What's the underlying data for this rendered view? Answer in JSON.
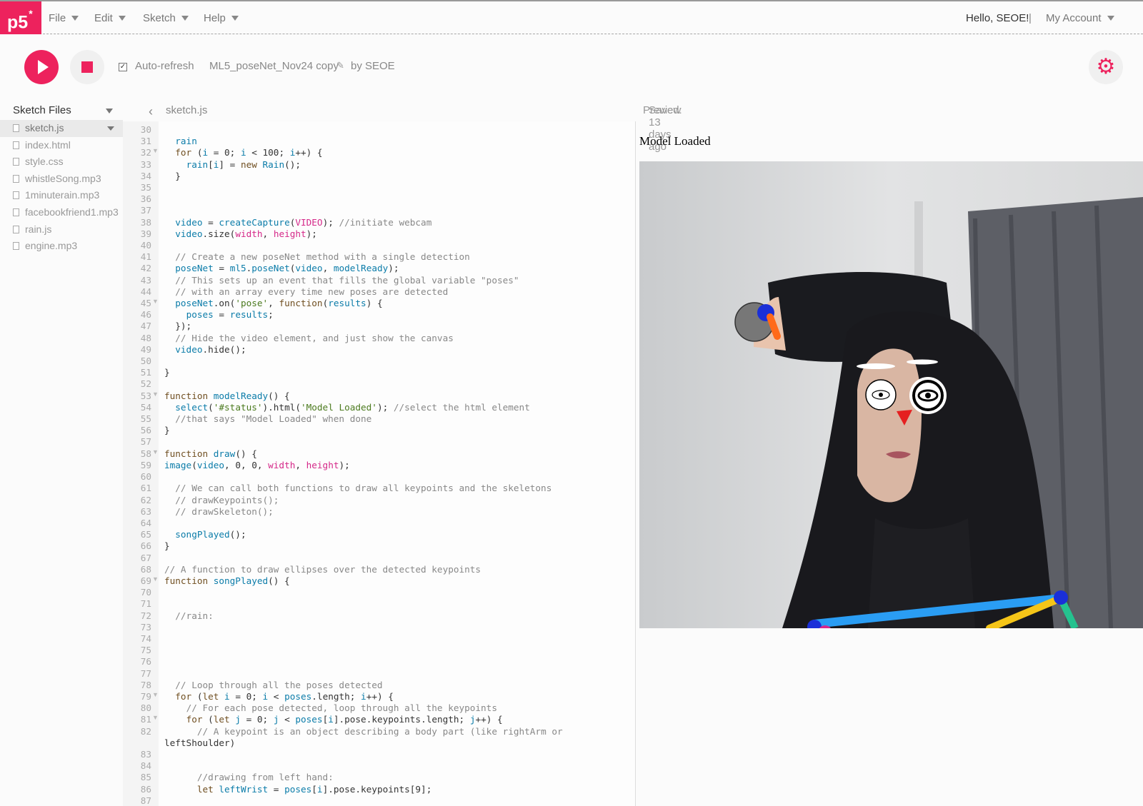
{
  "nav": {
    "logo": "p5",
    "logo_mark": "*",
    "menus": [
      "File",
      "Edit",
      "Sketch",
      "Help"
    ],
    "greeting": "Hello, SEOE!",
    "separator": "|",
    "account": "My Account"
  },
  "toolbar": {
    "auto_refresh_label": "Auto-refresh",
    "auto_refresh_checked": true,
    "project_name": "ML5_poseNet_Nov24 copy",
    "author": "by SEOE"
  },
  "sidebar": {
    "title": "Sketch Files",
    "files": [
      "sketch.js",
      "index.html",
      "style.css",
      "whistleSong.mp3",
      "1minuterain.mp3",
      "facebookfriend1.mp3",
      "rain.js",
      "engine.mp3"
    ],
    "selected": "sketch.js"
  },
  "editor": {
    "file_name": "sketch.js",
    "saved_status": "Saved: 13 days ago",
    "first_line": 30,
    "lines": [
      "",
      "  rain",
      "  for (i = 0; i < 100; i++) {",
      "    rain[i] = new Rain();",
      "  }",
      "",
      "",
      "",
      "  video = createCapture(VIDEO); //initiate webcam",
      "  video.size(width, height);",
      "",
      "  // Create a new poseNet method with a single detection",
      "  poseNet = ml5.poseNet(video, modelReady);",
      "  // This sets up an event that fills the global variable \"poses\"",
      "  // with an array every time new poses are detected",
      "  poseNet.on('pose', function(results) {",
      "    poses = results;",
      "  });",
      "  // Hide the video element, and just show the canvas",
      "  video.hide();",
      "",
      "}",
      "",
      "function modelReady() {",
      "  select('#status').html('Model Loaded'); //select the html element",
      "  //that says \"Model Loaded\" when done",
      "}",
      "",
      "function draw() {",
      "image(video, 0, 0, width, height);",
      "",
      "  // We can call both functions to draw all keypoints and the skeletons",
      "  // drawKeypoints();",
      "  // drawSkeleton();",
      "",
      "  songPlayed();",
      "}",
      "",
      "// A function to draw ellipses over the detected keypoints",
      "function songPlayed() {",
      "",
      "",
      "  //rain:",
      "",
      "",
      "",
      "",
      "",
      "  // Loop through all the poses detected",
      "  for (let i = 0; i < poses.length; i++) {",
      "    // For each pose detected, loop through all the keypoints",
      "    for (let j = 0; j < poses[i].pose.keypoints.length; j++) {",
      "      // A keypoint is an object describing a body part (like rightArm or\nleftShoulder)",
      "",
      "",
      "      //drawing from left hand:",
      "      let leftWrist = poses[i].pose.keypoints[9];",
      ""
    ],
    "fold_lines": [
      32,
      45,
      53,
      58,
      69,
      79,
      81
    ]
  },
  "preview": {
    "label": "Preview",
    "status": "Model Loaded"
  },
  "colors": {
    "accent": "#ed225d"
  }
}
